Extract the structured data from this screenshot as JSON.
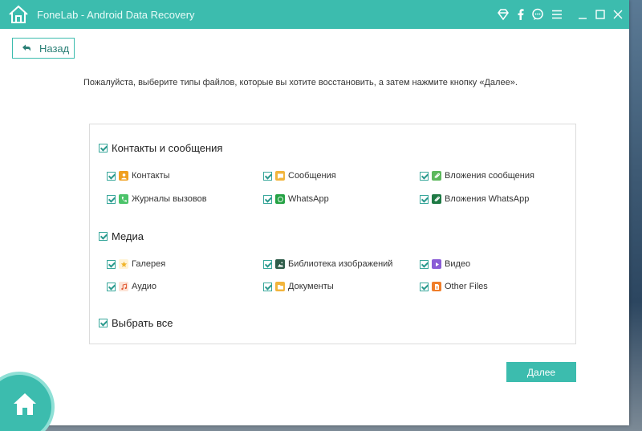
{
  "app": {
    "title": "FoneLab - Android Data Recovery"
  },
  "titlebar": {
    "icons": [
      "diamond-icon",
      "facebook-icon",
      "chat-icon",
      "menu-icon",
      "minimize-icon",
      "maximize-icon",
      "close-icon"
    ]
  },
  "nav": {
    "back_label": "Назад"
  },
  "instruction": "Пожалуйста, выберите типы файлов, которые вы хотите восстановить, а затем нажмите кнопку «Далее».",
  "groups": {
    "contacts": {
      "label": "Контакты и сообщения",
      "checked": true,
      "items": [
        {
          "label": "Контакты",
          "icon": "contacts-icon",
          "color": "#f0a020",
          "checked": true
        },
        {
          "label": "Сообщения",
          "icon": "messages-icon",
          "color": "#f2b53c",
          "checked": true
        },
        {
          "label": "Вложения сообщения",
          "icon": "attachment-icon",
          "color": "#5cb85c",
          "checked": true
        },
        {
          "label": "Журналы вызовов",
          "icon": "call-log-icon",
          "color": "#4cc36a",
          "checked": true
        },
        {
          "label": "WhatsApp",
          "icon": "whatsapp-icon",
          "color": "#25a244",
          "checked": true
        },
        {
          "label": "Вложения WhatsApp",
          "icon": "whatsapp-attachment-icon",
          "color": "#1f7a45",
          "checked": true
        }
      ]
    },
    "media": {
      "label": "Медиа",
      "checked": true,
      "items": [
        {
          "label": "Галерея",
          "icon": "gallery-icon",
          "color": "#f0b429",
          "checked": true
        },
        {
          "label": "Библиотека изображений",
          "icon": "image-library-icon",
          "color": "#2f5d4a",
          "checked": true
        },
        {
          "label": "Видео",
          "icon": "video-icon",
          "color": "#8a5cd6",
          "checked": true
        },
        {
          "label": "Аудио",
          "icon": "audio-icon",
          "color": "#e0552f",
          "checked": true
        },
        {
          "label": "Документы",
          "icon": "documents-icon",
          "color": "#f2b53c",
          "checked": true
        },
        {
          "label": "Other Files",
          "icon": "other-files-icon",
          "color": "#f07e2a",
          "checked": true
        }
      ]
    },
    "select_all": {
      "label": "Выбрать все",
      "checked": true
    }
  },
  "footer": {
    "next_label": "Далее"
  },
  "colors": {
    "accent": "#3cbcae",
    "accent_light": "#8fe0d6"
  }
}
